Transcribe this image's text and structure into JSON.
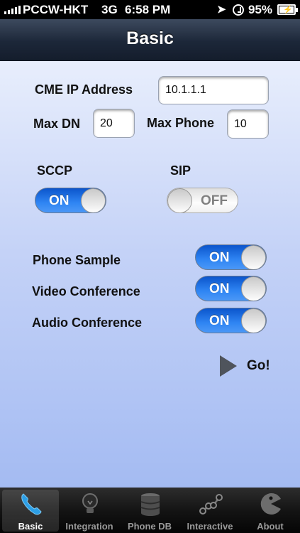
{
  "status_bar": {
    "carrier": "PCCW-HKT",
    "network": "3G",
    "time": "6:58 PM",
    "battery_percent": "95%"
  },
  "nav": {
    "title": "Basic"
  },
  "form": {
    "cme_ip_label": "CME IP Address",
    "cme_ip_value": "10.1.1.1",
    "max_dn_label": "Max DN",
    "max_dn_value": "20",
    "max_phone_label": "Max Phone",
    "max_phone_value": "10"
  },
  "protocols": {
    "sccp": {
      "label": "SCCP",
      "state": "ON"
    },
    "sip": {
      "label": "SIP",
      "state": "OFF"
    }
  },
  "options": [
    {
      "label": "Phone Sample",
      "state": "ON"
    },
    {
      "label": "Video Conference",
      "state": "ON"
    },
    {
      "label": "Audio Conference",
      "state": "ON"
    }
  ],
  "go": {
    "label": "Go!"
  },
  "tabs": [
    {
      "label": "Basic",
      "icon": "phone-icon",
      "active": true
    },
    {
      "label": "Integration",
      "icon": "lightbulb-icon",
      "active": false
    },
    {
      "label": "Phone DB",
      "icon": "database-icon",
      "active": false
    },
    {
      "label": "Interactive",
      "icon": "nodes-icon",
      "active": false
    },
    {
      "label": "About",
      "icon": "pacman-icon",
      "active": false
    }
  ],
  "colors": {
    "accent_on": "#2f85f3",
    "nav_bar": "#1c2739",
    "content_top": "#e8eefc",
    "content_bottom": "#a4bbf2"
  }
}
